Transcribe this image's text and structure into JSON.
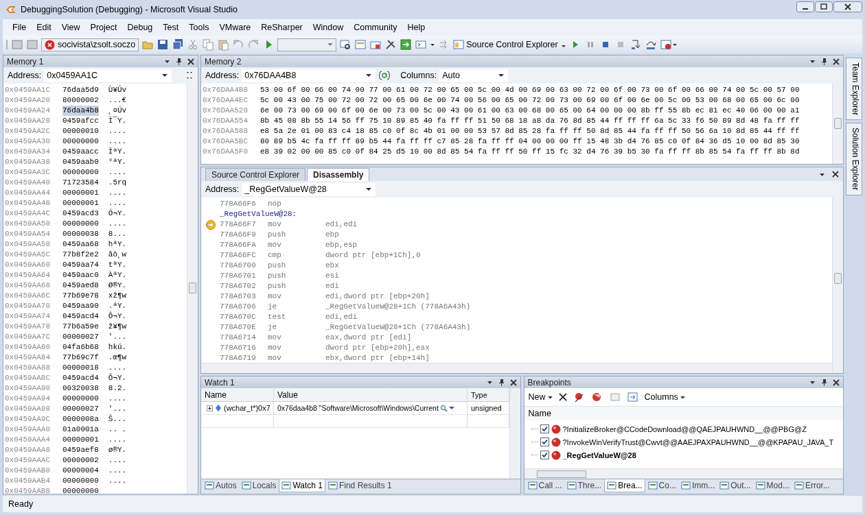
{
  "window": {
    "title": "DebuggingSolution (Debugging) - Microsoft Visual Studio"
  },
  "menu": [
    "File",
    "Edit",
    "View",
    "Project",
    "Debug",
    "Test",
    "Tools",
    "VMware",
    "ReSharper",
    "Window",
    "Community",
    "Help"
  ],
  "toolbar": {
    "user_combo": "socivista\\zsolt.soczo",
    "source_control_button": "Source Control Explorer"
  },
  "memory1": {
    "title": "Memory 1",
    "address_label": "Address:",
    "address": "0x0459AA1C",
    "rows": [
      {
        "address": "0x0459AA1C",
        "value": "76daa5d9",
        "text": "Ù¥Úv",
        "selected": false
      },
      {
        "address": "0x0459AA20",
        "value": "80000002",
        "text": "...€",
        "selected": false
      },
      {
        "address": "0x0459AA24",
        "value": "76daa4b8",
        "text": "¸¤Úv",
        "selected": true
      },
      {
        "address": "0x0459AA28",
        "value": "0459afcc",
        "text": "Ì¯Y.",
        "selected": false
      },
      {
        "address": "0x0459AA2C",
        "value": "00000010",
        "text": "....",
        "selected": false
      },
      {
        "address": "0x0459AA30",
        "value": "00000000",
        "text": "....",
        "selected": false
      },
      {
        "address": "0x0459AA34",
        "value": "0459aacc",
        "text": "ÌªY.",
        "selected": false
      },
      {
        "address": "0x0459AA38",
        "value": "0459aab0",
        "text": "°ªY.",
        "selected": false
      },
      {
        "address": "0x0459AA3C",
        "value": "00000000",
        "text": "....",
        "selected": false
      },
      {
        "address": "0x0459AA40",
        "value": "71723584",
        "text": ".5rq",
        "selected": false
      },
      {
        "address": "0x0459AA44",
        "value": "00000001",
        "text": "....",
        "selected": false
      },
      {
        "address": "0x0459AA48",
        "value": "00000001",
        "text": "....",
        "selected": false
      },
      {
        "address": "0x0459AA4C",
        "value": "0459acd3",
        "text": "Ó¬Y.",
        "selected": false
      },
      {
        "address": "0x0459AA50",
        "value": "00000000",
        "text": "....",
        "selected": false
      },
      {
        "address": "0x0459AA54",
        "value": "00000038",
        "text": "8...",
        "selected": false
      },
      {
        "address": "0x0459AA58",
        "value": "0459aa68",
        "text": "hªY.",
        "selected": false
      },
      {
        "address": "0x0459AA5C",
        "value": "77b8f2e2",
        "text": "âò¸w",
        "selected": false
      },
      {
        "address": "0x0459AA60",
        "value": "0459aa74",
        "text": "tªY.",
        "selected": false
      },
      {
        "address": "0x0459AA64",
        "value": "0459aac0",
        "text": "ÀªY.",
        "selected": false
      },
      {
        "address": "0x0459AA68",
        "value": "0459aed8",
        "text": "Ø®Y.",
        "selected": false
      },
      {
        "address": "0x0459AA6C",
        "value": "77b69e78",
        "text": "xž¶w",
        "selected": false
      },
      {
        "address": "0x0459AA70",
        "value": "0459aa90",
        "text": ".ªY.",
        "selected": false
      },
      {
        "address": "0x0459AA74",
        "value": "0459acd4",
        "text": "Ô¬Y.",
        "selected": false
      },
      {
        "address": "0x0459AA78",
        "value": "77b6a59e",
        "text": "ž¥¶w",
        "selected": false
      },
      {
        "address": "0x0459AA7C",
        "value": "00000027",
        "text": "'...",
        "selected": false
      },
      {
        "address": "0x0459AA80",
        "value": "04fa6b68",
        "text": "hkú.",
        "selected": false
      },
      {
        "address": "0x0459AA84",
        "value": "77b69c7f",
        "text": ".œ¶w",
        "selected": false
      },
      {
        "address": "0x0459AA88",
        "value": "00000018",
        "text": "....",
        "selected": false
      },
      {
        "address": "0x0459AA8C",
        "value": "0459acd4",
        "text": "Ô¬Y.",
        "selected": false
      },
      {
        "address": "0x0459AA90",
        "value": "00320038",
        "text": "8.2.",
        "selected": false
      },
      {
        "address": "0x0459AA94",
        "value": "00000000",
        "text": "....",
        "selected": false
      },
      {
        "address": "0x0459AA98",
        "value": "00000027",
        "text": "'...",
        "selected": false
      },
      {
        "address": "0x0459AA9C",
        "value": "0000008a",
        "text": "Š...",
        "selected": false
      },
      {
        "address": "0x0459AAA0",
        "value": "01a0001a",
        "text": ".. .",
        "selected": false
      },
      {
        "address": "0x0459AAA4",
        "value": "00000001",
        "text": "....",
        "selected": false
      },
      {
        "address": "0x0459AAA8",
        "value": "0459aef8",
        "text": "ø®Y.",
        "selected": false
      },
      {
        "address": "0x0459AAAC",
        "value": "00000002",
        "text": "....",
        "selected": false
      },
      {
        "address": "0x0459AAB0",
        "value": "00000004",
        "text": "....",
        "selected": false
      },
      {
        "address": "0x0459AAB4",
        "value": "00000000",
        "text": "....",
        "selected": false
      },
      {
        "address": "0x0459AAB8",
        "value": "00000000",
        "selected": false
      }
    ]
  },
  "memory2": {
    "title": "Memory 2",
    "address_label": "Address:",
    "address": "0x76DAA4B8",
    "columns_label": "Columns:",
    "columns": "Auto",
    "rows": [
      {
        "address": "0x76DAA4B8",
        "bytes": "53 00 6f 00 66 00 74 00 77 00 61 00 72 00 65 00 5c 00 4d 00 69 00 63 00 72 00 6f 00 73 00 6f 00 66 00 74 00 5c 00 57 00"
      },
      {
        "address": "0x76DAA4EC",
        "bytes": "5c 00 43 00 75 00 72 00 72 00 65 00 6e 00 74 00 56 00 65 00 72 00 73 00 69 00 6f 00 6e 00 5c 00 53 00 68 00 65 00 6c 00"
      },
      {
        "address": "0x76DAA520",
        "bytes": "6e 00 73 00 69 00 6f 00 6e 00 73 00 5c 00 43 00 61 00 63 00 68 00 65 00 64 00 00 00 8b ff 55 8b ec 81 ec 40 06 00 00 a1"
      },
      {
        "address": "0x76DAA554",
        "bytes": "8b 45 08 8b 55 14 56 ff 75 10 89 85 40 fa ff ff 51 50 68 18 a8 da 76 8d 85 44 ff ff ff 6a 5c 33 f6 50 89 8d 48 fa ff ff"
      },
      {
        "address": "0x76DAA588",
        "bytes": "e8 5a 2e 01 00 83 c4 18 85 c0 0f 8c 4b 01 00 00 53 57 8d 85 28 fa ff ff 50 8d 85 44 fa ff ff 50 56 6a 10 8d 85 44 ff ff"
      },
      {
        "address": "0x76DAA5BC",
        "bytes": "80 89 b5 4c fa ff ff 89 b5 44 fa ff ff c7 85 28 fa ff ff 04 00 00 00 ff 15 48 3b d4 76 85 c0 0f 84 36 d5 10 00 8d 85 30"
      },
      {
        "address": "0x76DAA5F0",
        "bytes": "e8 39 02 00 00 85 c0 0f 84 25 d5 10 00 8d 85 54 fa ff ff 50 ff 15 fc 32 d4 76 39 b5 30 fa ff ff 8b 85 54 fa ff ff 8b 8d"
      }
    ]
  },
  "document_tabs": [
    {
      "label": "Source Control Explorer",
      "selected": false
    },
    {
      "label": "Disassembly",
      "selected": true
    }
  ],
  "disassembly": {
    "address_label": "Address:",
    "address": "_RegGetValueW@28",
    "lines": [
      {
        "kind": "instruction",
        "address": "778A66F6",
        "op": "nop",
        "current": false
      },
      {
        "kind": "label",
        "text": "_RegGetValueW@28:"
      },
      {
        "kind": "instruction",
        "address": "778A66F7",
        "op": "mov",
        "args": "edi,edi",
        "current": true
      },
      {
        "kind": "instruction",
        "address": "778A66F9",
        "op": "push",
        "args": "ebp",
        "current": false
      },
      {
        "kind": "instruction",
        "address": "778A66FA",
        "op": "mov",
        "args": "ebp,esp",
        "current": false
      },
      {
        "kind": "instruction",
        "address": "778A66FC",
        "op": "cmp",
        "args": "dword ptr [ebp+1Ch],0",
        "current": false
      },
      {
        "kind": "instruction",
        "address": "778A6700",
        "op": "push",
        "args": "ebx",
        "current": false
      },
      {
        "kind": "instruction",
        "address": "778A6701",
        "op": "push",
        "args": "esi",
        "current": false
      },
      {
        "kind": "instruction",
        "address": "778A6702",
        "op": "push",
        "args": "edi",
        "current": false
      },
      {
        "kind": "instruction",
        "address": "778A6703",
        "op": "mov",
        "args": "edi,dword ptr [ebp+20h]",
        "current": false
      },
      {
        "kind": "instruction",
        "address": "778A6706",
        "op": "je",
        "args": "_RegGetValueW@28+1Ch (778A6A43h)",
        "current": false
      },
      {
        "kind": "instruction",
        "address": "778A670C",
        "op": "test",
        "args": "edi,edi",
        "current": false
      },
      {
        "kind": "instruction",
        "address": "778A670E",
        "op": "je",
        "args": "_RegGetValueW@28+1Ch (778A6A43h)",
        "current": false
      },
      {
        "kind": "instruction",
        "address": "778A6714",
        "op": "mov",
        "args": "eax,dword ptr [edi]",
        "current": false
      },
      {
        "kind": "instruction",
        "address": "778A6716",
        "op": "mov",
        "args": "dword ptr [ebp+20h],eax",
        "current": false
      },
      {
        "kind": "instruction",
        "address": "778A6719",
        "op": "mov",
        "args": "ebx,dword ptr [ebp+14h]",
        "current": false
      }
    ]
  },
  "watch": {
    "title": "Watch 1",
    "columns": [
      "Name",
      "Value",
      "Type"
    ],
    "rows": [
      {
        "name": "(wchar_t*)0x7",
        "value": "0x76daa4b8 \"Software\\Microsoft\\Windows\\Current",
        "type": "unsigned",
        "expanded": false
      }
    ]
  },
  "breakpoints": {
    "title": "Breakpoints",
    "new_button": "New",
    "columns_button": "Columns",
    "column": "Name",
    "items": [
      {
        "name": "?InitializeBroker@CCodeDownload@@QAEJPAUHWND__@@PBG@Z",
        "checked": true,
        "current": false
      },
      {
        "name": "?InvokeWinVerifyTrust@Cwvt@@AAEJPAXPAUHWND__@@KPAPAU_JAVA_T",
        "checked": true,
        "current": false
      },
      {
        "name": "_RegGetValueW@28",
        "checked": true,
        "current": true
      }
    ]
  },
  "bottom_left_tabs": [
    {
      "label": "Autos",
      "selected": false
    },
    {
      "label": "Locals",
      "selected": false
    },
    {
      "label": "Watch 1",
      "selected": true
    },
    {
      "label": "Find Results 1",
      "selected": false
    }
  ],
  "bottom_right_tabs": [
    {
      "label": "Call ...",
      "selected": false
    },
    {
      "label": "Thre...",
      "selected": false
    },
    {
      "label": "Brea...",
      "selected": true
    },
    {
      "label": "Co...",
      "selected": false
    },
    {
      "label": "Imm...",
      "selected": false
    },
    {
      "label": "Out...",
      "selected": false
    },
    {
      "label": "Mod...",
      "selected": false
    },
    {
      "label": "Error...",
      "selected": false
    }
  ],
  "side_tabs": [
    "Team Explorer",
    "Solution Explorer"
  ],
  "status_bar": {
    "text": "Ready"
  }
}
